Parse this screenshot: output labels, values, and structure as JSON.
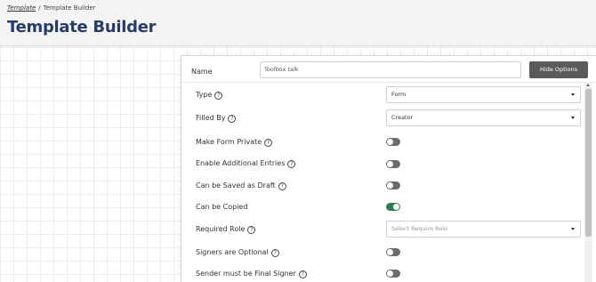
{
  "breadcrumb": {
    "link": "Template",
    "separator": "/",
    "current": "Template Builder"
  },
  "page_title": "Template Builder",
  "name_field": {
    "label": "Name",
    "value": "Toolbox talk"
  },
  "hide_options_button": "Hide Options",
  "fields": {
    "type": {
      "label": "Type",
      "value": "Form"
    },
    "filled_by": {
      "label": "Filled By",
      "value": "Creator"
    },
    "make_form_private": {
      "label": "Make Form Private",
      "on": false
    },
    "enable_additional_entries": {
      "label": "Enable Additional Entries",
      "on": false
    },
    "can_be_saved_as_draft": {
      "label": "Can be Saved as Draft",
      "on": false
    },
    "can_be_copied": {
      "label": "Can be Copied",
      "on": true
    },
    "required_role": {
      "label": "Required Role",
      "placeholder": "Select Require Role"
    },
    "signers_are_optional": {
      "label": "Signers are Optional",
      "on": false
    },
    "sender_must_be_final_signer": {
      "label": "Sender must be Final Signer",
      "on": false
    }
  },
  "colors": {
    "title": "#283c66",
    "toggle_on": "#2f7d54",
    "toggle_off": "#6b6b6b",
    "button": "#5b5b5b"
  },
  "icons": {
    "help": "question-circle-icon",
    "dropdown": "chevron-down-icon"
  }
}
